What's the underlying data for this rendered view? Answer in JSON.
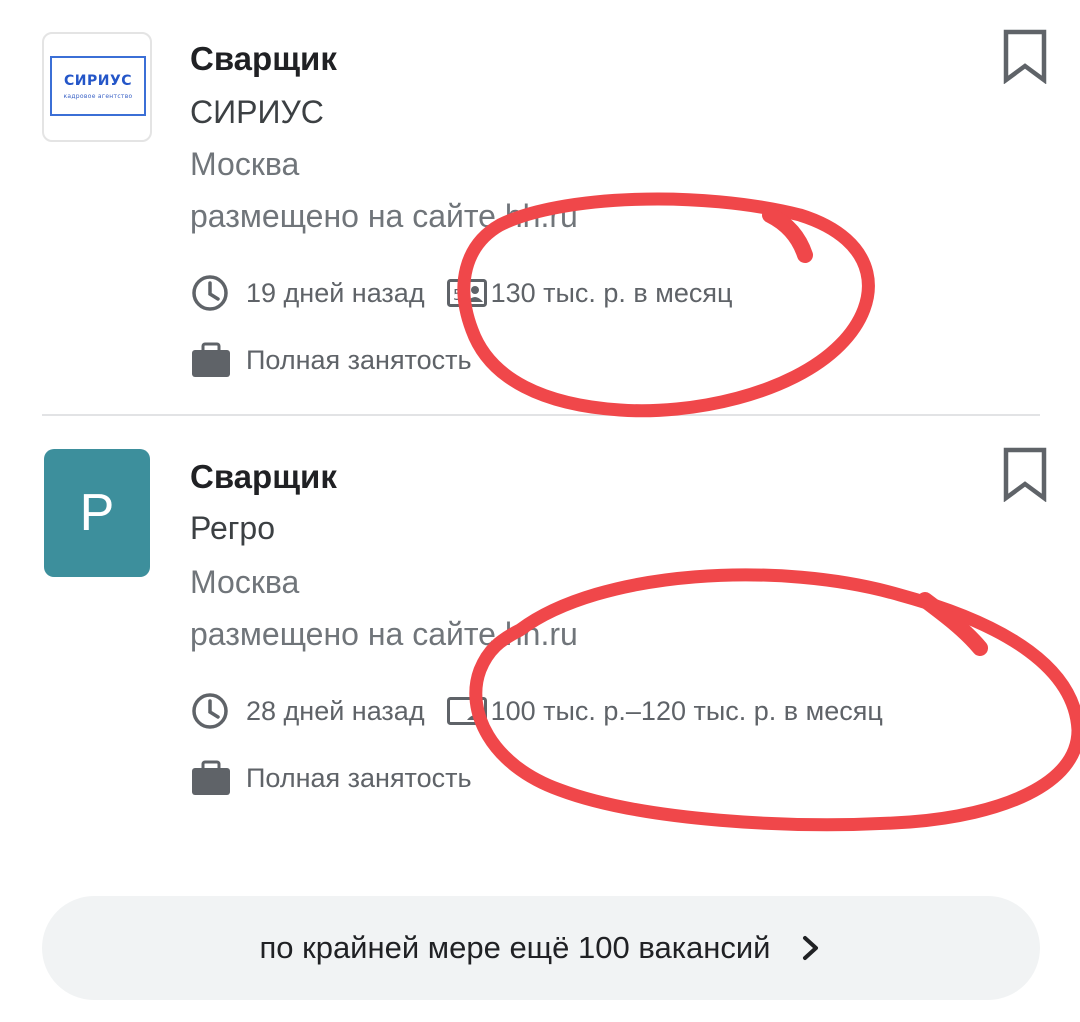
{
  "jobs": [
    {
      "title": "Сварщик",
      "company": "СИРИУС",
      "city": "Москва",
      "source": "размещено на сайте hh.ru",
      "posted": "19 дней назад",
      "salary": "130 тыс. р. в месяц",
      "employment": "Полная занятость",
      "logo": {
        "type": "image",
        "text": "СИРИУС",
        "subtext": "кадровое агентство"
      }
    },
    {
      "title": "Сварщик",
      "company": "Регро",
      "city": "Москва",
      "source": "размещено на сайте hh.ru",
      "posted": "28 дней назад",
      "salary": "100 тыс. р.–120 тыс. р. в месяц",
      "employment": "Полная занятость",
      "logo": {
        "type": "letter",
        "letter": "Р",
        "color": "#3d8f9c"
      }
    }
  ],
  "more_button": {
    "label": "по крайней мере ещё 100 вакансий"
  },
  "icons": {
    "clock": "clock-icon",
    "salary": "salary-card-icon",
    "employment": "briefcase-icon",
    "bookmark": "bookmark-icon",
    "chevron": "chevron-right-icon"
  },
  "colors": {
    "annotation": "#f0474a",
    "icon_gray": "#5f6368",
    "logo_tile": "#3d8f9c"
  }
}
